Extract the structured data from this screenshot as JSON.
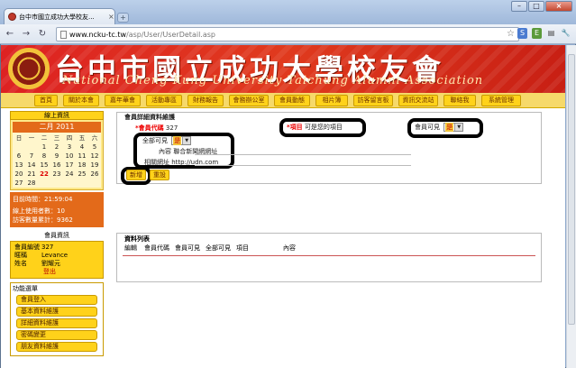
{
  "browser": {
    "tab_title": "台中市國立成功大學校友...",
    "tab_close": "×",
    "new_tab": "+",
    "window_buttons": [
      "–",
      "□",
      "×"
    ],
    "nav": {
      "back": "←",
      "forward": "→",
      "reload": "↻"
    },
    "url_prefix": "www.ncku-tc.tw",
    "url_path": "/asp/User/UserDetail.asp",
    "star": "☆",
    "toolbar_icons": [
      "S",
      "E",
      "▤",
      "🔧"
    ]
  },
  "header": {
    "title": "台中市國立成功大學校友會",
    "subtitle": "National Cheng Kung University Taichung Alumni Association"
  },
  "menu": [
    "首頁",
    "關於本會",
    "嘉年華會",
    "活動專區",
    "財務報告",
    "會務辦公室",
    "會員動態",
    "相片簿",
    "訪客留言板",
    "資訊交流站",
    "聯絡我",
    "系統管理"
  ],
  "sidebar": {
    "online_title": "線上資訊",
    "calendar": {
      "month_title": "二月 2011",
      "weekdays": [
        "日",
        "一",
        "二",
        "三",
        "四",
        "五",
        "六"
      ],
      "days": [
        "",
        "",
        "1",
        "2",
        "3",
        "4",
        "5",
        "6",
        "7",
        "8",
        "9",
        "10",
        "11",
        "12",
        "13",
        "14",
        "15",
        "16",
        "17",
        "18",
        "19",
        "20",
        "21",
        "22",
        "23",
        "24",
        "25",
        "26",
        "27",
        "28",
        "",
        "",
        "",
        "",
        ""
      ],
      "today": "22"
    },
    "stats": {
      "time": "目前時間：21:59:04",
      "online": "線上使用者數：10",
      "visits": "訪客數量累計：9362"
    },
    "member": {
      "title": "會員資訊",
      "rows": [
        {
          "k": "會員編號",
          "v": "327"
        },
        {
          "k": "暱稱",
          "v": "Levance"
        },
        {
          "k": "姓名",
          "v": "劉耀元"
        }
      ],
      "logout": "登出"
    },
    "functions": {
      "title": "功能選單",
      "items": [
        "會員登入",
        "基本資料維護",
        "詳細資料維護",
        "密碼變更",
        "朋友資料維護"
      ]
    }
  },
  "form": {
    "title": "會員詳細資料維護",
    "member_code_label": "*會員代碼",
    "member_code_value": "327",
    "required_note_star": "*項目",
    "required_note_rest": "可是您的項目",
    "public_label": "會員可見",
    "public_value": "是",
    "all_visible_label": "全部可見",
    "all_visible_value": "是",
    "content_label": "內容",
    "content_value": "聯合新聞網網址",
    "url_label": "相關網址",
    "url_value": "http://udn.com",
    "add_button": "新增",
    "reset_button": "重設"
  },
  "list": {
    "title": "資料列表",
    "columns": [
      "編輯",
      "會員代碼",
      "會員可見",
      "全部可見",
      "項目",
      "內容"
    ]
  }
}
